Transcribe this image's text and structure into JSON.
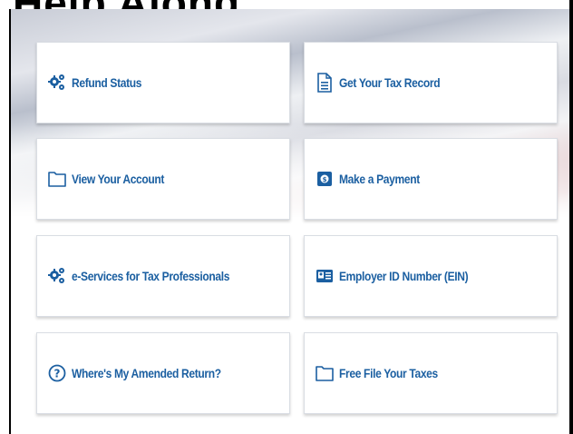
{
  "heading": "Help Along",
  "tiles": [
    {
      "label": "Refund Status",
      "icon": "gears-icon"
    },
    {
      "label": "Get Your Tax Record",
      "icon": "document-icon"
    },
    {
      "label": "View Your Account",
      "icon": "folder-icon"
    },
    {
      "label": "Make a Payment",
      "icon": "payment-icon"
    },
    {
      "label": "e-Services for Tax Professionals",
      "icon": "gears-icon"
    },
    {
      "label": "Employer ID Number (EIN)",
      "icon": "id-card-icon"
    },
    {
      "label": "Where's My Amended Return?",
      "icon": "question-circle-icon"
    },
    {
      "label": "Free File Your Taxes",
      "icon": "folder-icon"
    }
  ],
  "colors": {
    "link": "#1b5fa1",
    "tile_border": "#d9dde3"
  }
}
